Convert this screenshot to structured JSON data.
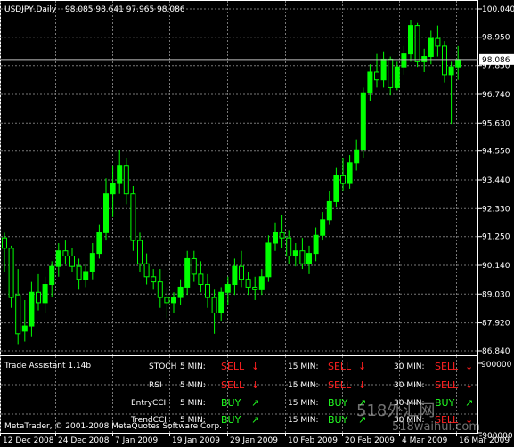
{
  "window": {
    "title": "USDJPY,Daily",
    "ohlc": "98.085 98.641 97.965 98.086",
    "current_price": "98.086"
  },
  "price_axis": {
    "ticks": [
      "100.040",
      "98.950",
      "97.850",
      "96.740",
      "95.630",
      "94.550",
      "93.440",
      "92.330",
      "91.250",
      "90.140",
      "89.030",
      "87.920",
      "86.840"
    ],
    "current_label": "98.086"
  },
  "date_axis": {
    "ticks": [
      "12 Dec 2008",
      "24 Dec 2008",
      "7 Jan 2009",
      "19 Jan 2009",
      "29 Jan 2009",
      "10 Feb 2009",
      "20 Feb 2009",
      "4 Mar 2009",
      "16 Mar 2009"
    ]
  },
  "indicator": {
    "title": "Trade Assistant 1.14b",
    "scale_top": "900000",
    "scale_bottom": "-900000",
    "timeframes": [
      "5 MIN:",
      "15 MIN:",
      "30 MIN:"
    ],
    "rows": [
      {
        "name": "STOCH",
        "signals": [
          "SELL",
          "SELL",
          "SELL"
        ],
        "arrows": [
          "↓",
          "↓",
          "↓"
        ]
      },
      {
        "name": "RSI",
        "signals": [
          "SELL",
          "SELL",
          "SELL"
        ],
        "arrows": [
          "↓",
          "↓",
          "↓"
        ]
      },
      {
        "name": "EntryCCI",
        "signals": [
          "BUY",
          "BUY",
          "BUY"
        ],
        "arrows": [
          "↗",
          "↗",
          "↗"
        ]
      },
      {
        "name": "TrendCCI",
        "signals": [
          "BUY",
          "BUY",
          "SELL"
        ],
        "arrows": [
          "↗",
          "↗",
          "↓"
        ]
      }
    ]
  },
  "copyright": "MetaTrader, © 2001-2008 MetaQuotes Software Corp.",
  "watermark": {
    "line1": "518外汇网",
    "line2": "518waihui.com"
  },
  "colors": {
    "bull": "#00ff00",
    "bear": "#000000",
    "grid": "#777777",
    "sell": "#ff2020",
    "buy": "#22ff22"
  },
  "chart_data": {
    "type": "candlestick",
    "title": "USDJPY,Daily",
    "y_range": [
      86.84,
      100.04
    ],
    "x_labels": [
      "12 Dec 2008",
      "24 Dec 2008",
      "7 Jan 2009",
      "19 Jan 2009",
      "29 Jan 2009",
      "10 Feb 2009",
      "20 Feb 2009",
      "4 Mar 2009",
      "16 Mar 2009"
    ],
    "candles": [
      {
        "o": 91.2,
        "h": 91.4,
        "l": 89.9,
        "c": 90.8
      },
      {
        "o": 90.8,
        "h": 90.9,
        "l": 88.5,
        "c": 88.9
      },
      {
        "o": 89.0,
        "h": 90.0,
        "l": 87.1,
        "c": 87.5
      },
      {
        "o": 87.6,
        "h": 88.8,
        "l": 87.2,
        "c": 87.8
      },
      {
        "o": 87.8,
        "h": 89.5,
        "l": 87.4,
        "c": 89.1
      },
      {
        "o": 89.1,
        "h": 89.8,
        "l": 88.4,
        "c": 88.7
      },
      {
        "o": 88.7,
        "h": 89.7,
        "l": 88.3,
        "c": 89.4
      },
      {
        "o": 89.4,
        "h": 90.3,
        "l": 88.9,
        "c": 90.1
      },
      {
        "o": 90.1,
        "h": 91.0,
        "l": 89.7,
        "c": 90.7
      },
      {
        "o": 90.7,
        "h": 91.1,
        "l": 90.2,
        "c": 90.5
      },
      {
        "o": 90.5,
        "h": 90.8,
        "l": 89.9,
        "c": 90.1
      },
      {
        "o": 90.1,
        "h": 90.4,
        "l": 89.2,
        "c": 89.6
      },
      {
        "o": 89.6,
        "h": 90.2,
        "l": 89.3,
        "c": 89.9
      },
      {
        "o": 89.9,
        "h": 91.0,
        "l": 89.6,
        "c": 90.6
      },
      {
        "o": 90.6,
        "h": 91.7,
        "l": 90.4,
        "c": 91.4
      },
      {
        "o": 91.4,
        "h": 93.5,
        "l": 91.1,
        "c": 92.9
      },
      {
        "o": 92.9,
        "h": 94.0,
        "l": 92.0,
        "c": 93.3
      },
      {
        "o": 93.3,
        "h": 94.6,
        "l": 92.9,
        "c": 94.0
      },
      {
        "o": 94.0,
        "h": 94.3,
        "l": 92.5,
        "c": 92.9
      },
      {
        "o": 92.9,
        "h": 93.2,
        "l": 90.7,
        "c": 91.1
      },
      {
        "o": 91.1,
        "h": 91.4,
        "l": 89.9,
        "c": 90.2
      },
      {
        "o": 90.2,
        "h": 90.6,
        "l": 89.4,
        "c": 89.7
      },
      {
        "o": 89.7,
        "h": 90.0,
        "l": 89.2,
        "c": 89.5
      },
      {
        "o": 89.5,
        "h": 90.0,
        "l": 88.5,
        "c": 88.9
      },
      {
        "o": 88.9,
        "h": 89.3,
        "l": 88.1,
        "c": 88.7
      },
      {
        "o": 88.7,
        "h": 89.1,
        "l": 88.3,
        "c": 88.9
      },
      {
        "o": 88.9,
        "h": 89.6,
        "l": 88.6,
        "c": 89.3
      },
      {
        "o": 89.3,
        "h": 90.7,
        "l": 89.0,
        "c": 90.4
      },
      {
        "o": 90.4,
        "h": 90.7,
        "l": 89.5,
        "c": 89.8
      },
      {
        "o": 89.8,
        "h": 90.3,
        "l": 89.1,
        "c": 89.4
      },
      {
        "o": 89.4,
        "h": 89.8,
        "l": 88.5,
        "c": 88.9
      },
      {
        "o": 88.9,
        "h": 89.2,
        "l": 87.5,
        "c": 88.3
      },
      {
        "o": 88.3,
        "h": 89.3,
        "l": 88.0,
        "c": 89.1
      },
      {
        "o": 89.1,
        "h": 89.7,
        "l": 88.6,
        "c": 89.4
      },
      {
        "o": 89.4,
        "h": 90.4,
        "l": 89.0,
        "c": 90.1
      },
      {
        "o": 90.1,
        "h": 90.7,
        "l": 89.3,
        "c": 89.6
      },
      {
        "o": 89.6,
        "h": 89.9,
        "l": 89.0,
        "c": 89.3
      },
      {
        "o": 89.3,
        "h": 89.7,
        "l": 88.8,
        "c": 89.2
      },
      {
        "o": 89.2,
        "h": 90.0,
        "l": 89.0,
        "c": 89.7
      },
      {
        "o": 89.7,
        "h": 91.3,
        "l": 89.5,
        "c": 91.0
      },
      {
        "o": 91.0,
        "h": 91.8,
        "l": 90.7,
        "c": 91.4
      },
      {
        "o": 91.4,
        "h": 92.1,
        "l": 90.8,
        "c": 91.2
      },
      {
        "o": 91.2,
        "h": 91.5,
        "l": 90.2,
        "c": 90.5
      },
      {
        "o": 90.5,
        "h": 91.0,
        "l": 90.1,
        "c": 90.7
      },
      {
        "o": 90.7,
        "h": 91.2,
        "l": 90.0,
        "c": 90.2
      },
      {
        "o": 90.2,
        "h": 90.9,
        "l": 89.8,
        "c": 90.6
      },
      {
        "o": 90.6,
        "h": 91.6,
        "l": 90.3,
        "c": 91.3
      },
      {
        "o": 91.3,
        "h": 92.2,
        "l": 91.1,
        "c": 91.9
      },
      {
        "o": 91.9,
        "h": 93.0,
        "l": 91.7,
        "c": 92.6
      },
      {
        "o": 92.6,
        "h": 93.9,
        "l": 92.4,
        "c": 93.6
      },
      {
        "o": 93.6,
        "h": 94.3,
        "l": 93.0,
        "c": 93.3
      },
      {
        "o": 93.3,
        "h": 94.4,
        "l": 93.1,
        "c": 94.1
      },
      {
        "o": 94.1,
        "h": 95.0,
        "l": 93.8,
        "c": 94.6
      },
      {
        "o": 94.6,
        "h": 97.0,
        "l": 94.3,
        "c": 96.8
      },
      {
        "o": 96.8,
        "h": 97.9,
        "l": 96.5,
        "c": 97.6
      },
      {
        "o": 97.6,
        "h": 98.3,
        "l": 97.0,
        "c": 97.3
      },
      {
        "o": 97.3,
        "h": 98.4,
        "l": 97.0,
        "c": 98.1
      },
      {
        "o": 98.1,
        "h": 98.2,
        "l": 96.7,
        "c": 97.0
      },
      {
        "o": 97.0,
        "h": 98.0,
        "l": 96.9,
        "c": 97.8
      },
      {
        "o": 97.8,
        "h": 98.6,
        "l": 97.5,
        "c": 98.3
      },
      {
        "o": 98.3,
        "h": 99.6,
        "l": 98.0,
        "c": 99.4
      },
      {
        "o": 99.4,
        "h": 99.5,
        "l": 97.8,
        "c": 98.0
      },
      {
        "o": 98.0,
        "h": 98.5,
        "l": 97.6,
        "c": 98.2
      },
      {
        "o": 98.2,
        "h": 99.2,
        "l": 97.9,
        "c": 98.9
      },
      {
        "o": 98.9,
        "h": 99.4,
        "l": 98.2,
        "c": 98.6
      },
      {
        "o": 98.6,
        "h": 98.8,
        "l": 97.2,
        "c": 97.5
      },
      {
        "o": 97.5,
        "h": 98.0,
        "l": 95.6,
        "c": 97.8
      },
      {
        "o": 97.8,
        "h": 98.6,
        "l": 97.3,
        "c": 98.086
      }
    ]
  }
}
